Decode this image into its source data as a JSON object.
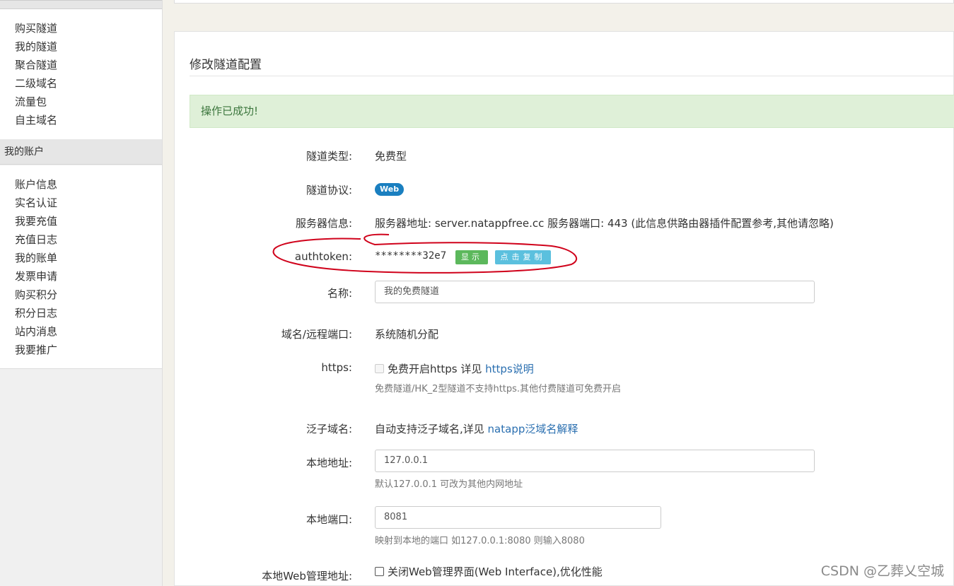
{
  "sidebar": {
    "tunnel_items": [
      {
        "label": "购买隧道"
      },
      {
        "label": "我的隧道"
      },
      {
        "label": "聚合隧道"
      },
      {
        "label": "二级域名"
      },
      {
        "label": "流量包"
      },
      {
        "label": "自主域名"
      }
    ],
    "account_header": "我的账户",
    "account_items": [
      {
        "label": "账户信息"
      },
      {
        "label": "实名认证"
      },
      {
        "label": "我要充值"
      },
      {
        "label": "充值日志"
      },
      {
        "label": "我的账单"
      },
      {
        "label": "发票申请"
      },
      {
        "label": "购买积分"
      },
      {
        "label": "积分日志"
      },
      {
        "label": "站内消息"
      },
      {
        "label": "我要推广"
      }
    ]
  },
  "main": {
    "title": "修改隧道配置",
    "alert": "操作已成功!",
    "fields": {
      "tunnel_type": {
        "label": "隧道类型:",
        "value": "免费型"
      },
      "protocol": {
        "label": "隧道协议:",
        "badge": "Web"
      },
      "server_info": {
        "label": "服务器信息:",
        "value": "服务器地址: server.natappfree.cc 服务器端口: 443 (此信息供路由器插件配置参考,其他请忽略)"
      },
      "authtoken": {
        "label": "authtoken:",
        "value": "********32e7",
        "show_button": "显示",
        "copy_button": "点击复制"
      },
      "name": {
        "label": "名称:",
        "value": "我的免费隧道"
      },
      "domain": {
        "label": "域名/远程端口:",
        "value": "系统随机分配"
      },
      "https": {
        "label": "https:",
        "checkbox_text": "免费开启https 详见 ",
        "link": "https说明",
        "help": "免费隧道/HK_2型隧道不支持https.其他付费隧道可免费开启"
      },
      "wildcard": {
        "label": "泛子域名:",
        "text": "自动支持泛子域名,详见 ",
        "link": "natapp泛域名解释"
      },
      "local_address": {
        "label": "本地地址:",
        "value": "127.0.0.1",
        "help": "默认127.0.0.1 可改为其他内网地址"
      },
      "local_port": {
        "label": "本地端口:",
        "value": "8081",
        "help": "映射到本地的端口 如127.0.0.1:8080 则输入8080"
      },
      "web_admin": {
        "label": "本地Web管理地址:",
        "checkbox_text": "关闭Web管理界面(Web Interface),优化性能"
      }
    }
  },
  "watermark": "CSDN @乙葬乂空城",
  "colors": {
    "alert_bg": "#dff0d8",
    "alert_text": "#3c763d",
    "badge": "#1a7fc0",
    "show_btn": "#5cb85c",
    "copy_btn": "#5bc0de",
    "link": "#2a6fb0",
    "annotation": "#d0021b"
  }
}
